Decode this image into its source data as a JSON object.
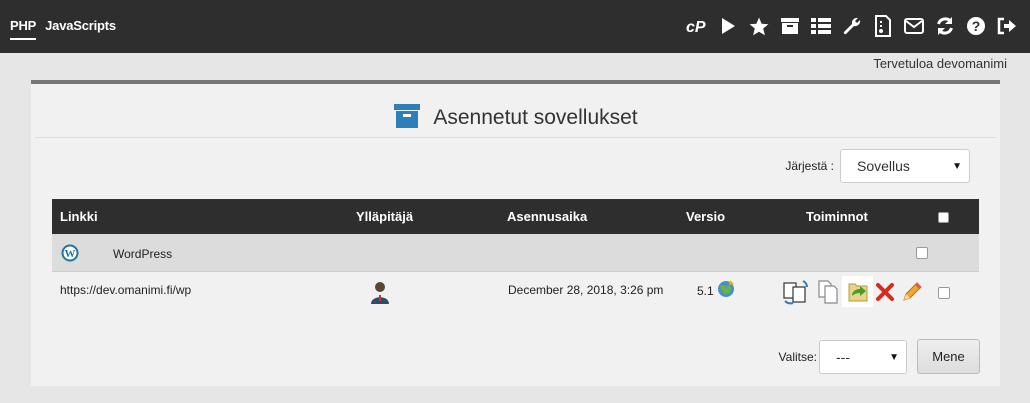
{
  "topbar": {
    "nav": [
      {
        "label": "PHP",
        "active": true
      },
      {
        "label": "JavaScripts",
        "active": false
      }
    ],
    "icons": [
      "cpanel-icon",
      "play-icon",
      "star-icon",
      "archive-icon",
      "list-icon",
      "wrench-icon",
      "script-icon",
      "mail-icon",
      "refresh-icon",
      "help-icon",
      "logout-icon"
    ]
  },
  "welcome": "Tervetuloa devomanimi",
  "panel": {
    "title": "Asennetut sovellukset",
    "sort_label": "Järjestä :",
    "sort_value": "Sovellus"
  },
  "table": {
    "headers": {
      "link": "Linkki",
      "admin": "Ylläpitäjä",
      "installed": "Asennusaika",
      "version": "Versio",
      "actions": "Toiminnot"
    },
    "group": {
      "name": "WordPress"
    },
    "rows": [
      {
        "link": "https://dev.omanimi.fi/wp",
        "installed": "December 28, 2018, 3:26 pm",
        "version": "5.1"
      }
    ]
  },
  "bottom": {
    "select_label": "Valitse:",
    "select_value": "---",
    "go_button": "Mene"
  },
  "colors": {
    "topbar": "#2e2e2e",
    "panel": "#f1f1f1",
    "accent": "#2c7fb8"
  }
}
